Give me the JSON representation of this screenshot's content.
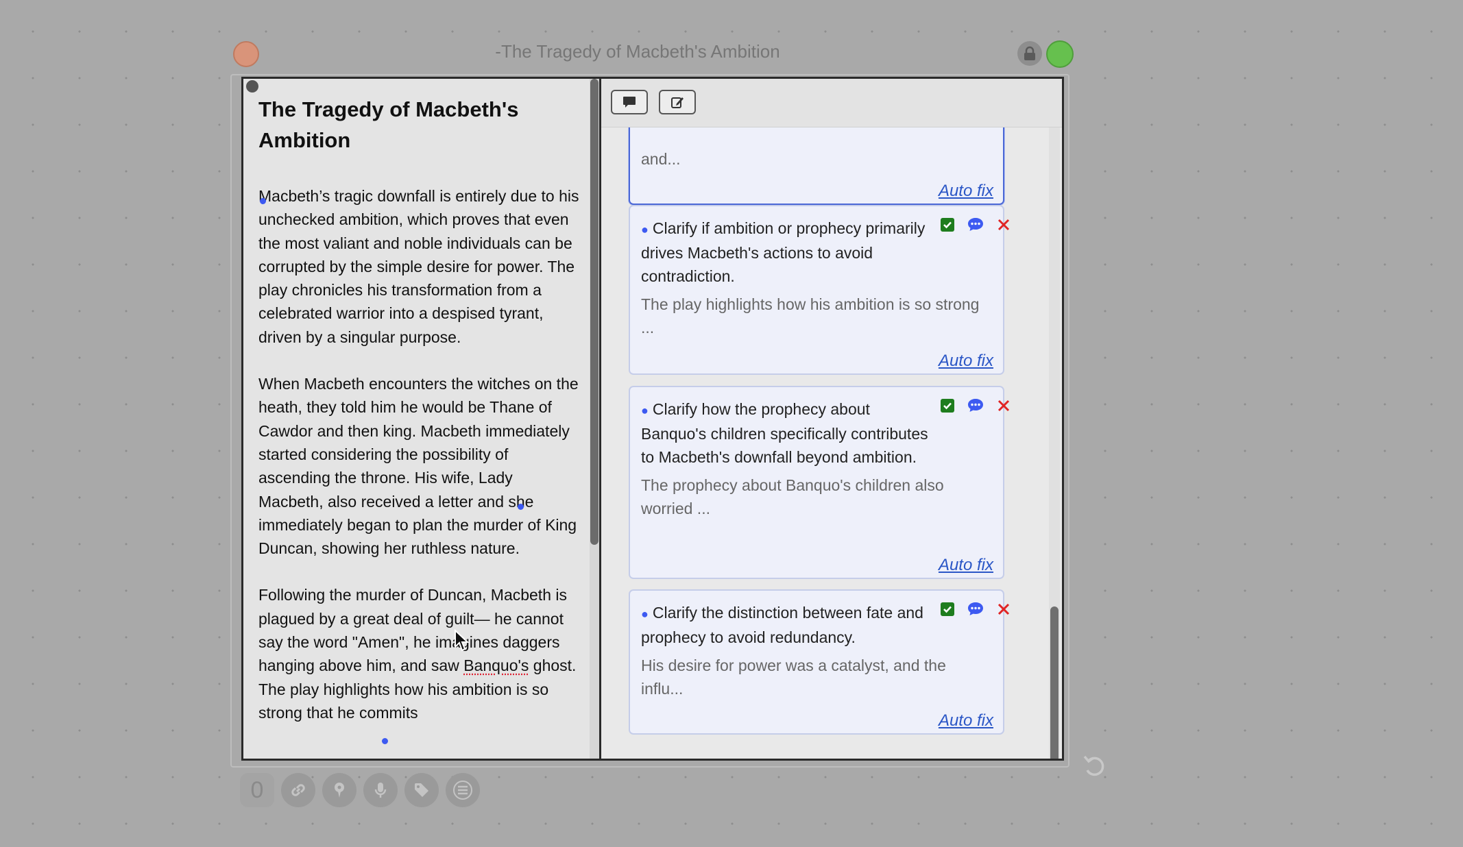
{
  "window": {
    "title": "-The Tragedy of Macbeth's Ambition",
    "close_symbol": "×"
  },
  "document": {
    "heading": "The Tragedy of Macbeth's Ambition",
    "paragraphs": [
      "Macbeth’s tragic downfall is entirely due to his unchecked ambition, which proves that even the most valiant and noble individuals can be corrupted by the simple desire for power. The play chronicles his transformation from a celebrated warrior into a despised tyrant, driven by a singular purpose.",
      "When Macbeth encounters the witches on the heath, they told him he would be Thane of Cawdor and then king. Macbeth immediately started considering the possibility of ascending the throne. His wife, Lady Macbeth, also received a letter and she immediately began to plan the murder of King Duncan, showing her ruthless nature."
    ],
    "paragraph3": {
      "before": "Following the murder of Duncan, Macbeth is plagued by a great deal of guilt— he cannot say the word \"Amen\", he imagines daggers hanging above him, and saw ",
      "misspelled": "Banquo's",
      "after": " ghost. The play highlights how his ambition is so strong that he commits"
    }
  },
  "suggestions": {
    "partial": {
      "excerpt_tail": "and...",
      "autofix_label": "Auto fix"
    },
    "items": [
      {
        "title": "Clarify if ambition or prophecy primarily drives Macbeth's actions to avoid contradiction.",
        "excerpt": "The play highlights how his ambition is so strong ...",
        "autofix_label": "Auto fix"
      },
      {
        "title": "Clarify how the prophecy about Banquo's children specifically contributes to Macbeth's downfall beyond ambition.",
        "excerpt": "The prophecy about Banquo's children also worried ...",
        "autofix_label": "Auto fix"
      },
      {
        "title": "Clarify the distinction between fate and prophecy to avoid redundancy.",
        "excerpt": "His desire for power was a catalyst, and the influ...",
        "autofix_label": "Auto fix"
      }
    ]
  },
  "bottom_bar": {
    "count": "0",
    "icons": [
      "link-icon",
      "pin-icon",
      "microphone-icon",
      "tag-icon",
      "menu-icon"
    ]
  },
  "colors": {
    "accent": "#3d5af1",
    "autofix_link": "#2a56c6",
    "check_green": "#1e7d1e",
    "dismiss_red": "#e02424",
    "title_dot_red": "#d9947a",
    "title_dot_green": "#66c04e"
  }
}
